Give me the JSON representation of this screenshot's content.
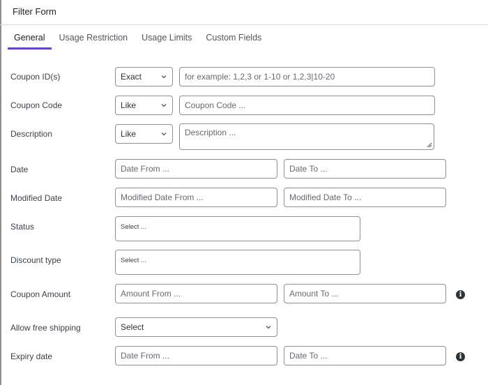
{
  "header": {
    "title": "Filter Form"
  },
  "tabs": [
    {
      "label": "General",
      "active": true
    },
    {
      "label": "Usage Restriction",
      "active": false
    },
    {
      "label": "Usage Limits",
      "active": false
    },
    {
      "label": "Custom Fields",
      "active": false
    }
  ],
  "colors": {
    "accent": "#6642c7",
    "border": "#8c8f94",
    "info_icon": "#2c3338"
  },
  "fields": {
    "coupon_ids": {
      "label": "Coupon ID(s)",
      "operator": "Exact",
      "placeholder": "for example: 1,2,3 or 1-10 or 1,2,3|10-20"
    },
    "coupon_code": {
      "label": "Coupon Code",
      "operator": "Like",
      "placeholder": "Coupon Code ..."
    },
    "description": {
      "label": "Description",
      "operator": "Like",
      "placeholder": "Description ..."
    },
    "date": {
      "label": "Date",
      "from_placeholder": "Date From ...",
      "to_placeholder": "Date To ..."
    },
    "modified_date": {
      "label": "Modified Date",
      "from_placeholder": "Modified Date From ...",
      "to_placeholder": "Modified Date To ..."
    },
    "status": {
      "label": "Status",
      "placeholder": "Select ..."
    },
    "discount_type": {
      "label": "Discount type",
      "placeholder": "Select ..."
    },
    "coupon_amount": {
      "label": "Coupon Amount",
      "from_placeholder": "Amount From ...",
      "to_placeholder": "Amount To ...",
      "info_icon": "info-icon"
    },
    "free_shipping": {
      "label": "Allow free shipping",
      "value": "Select"
    },
    "expiry_date": {
      "label": "Expiry date",
      "from_placeholder": "Date From ...",
      "to_placeholder": "Date To ...",
      "info_icon": "info-icon"
    }
  }
}
